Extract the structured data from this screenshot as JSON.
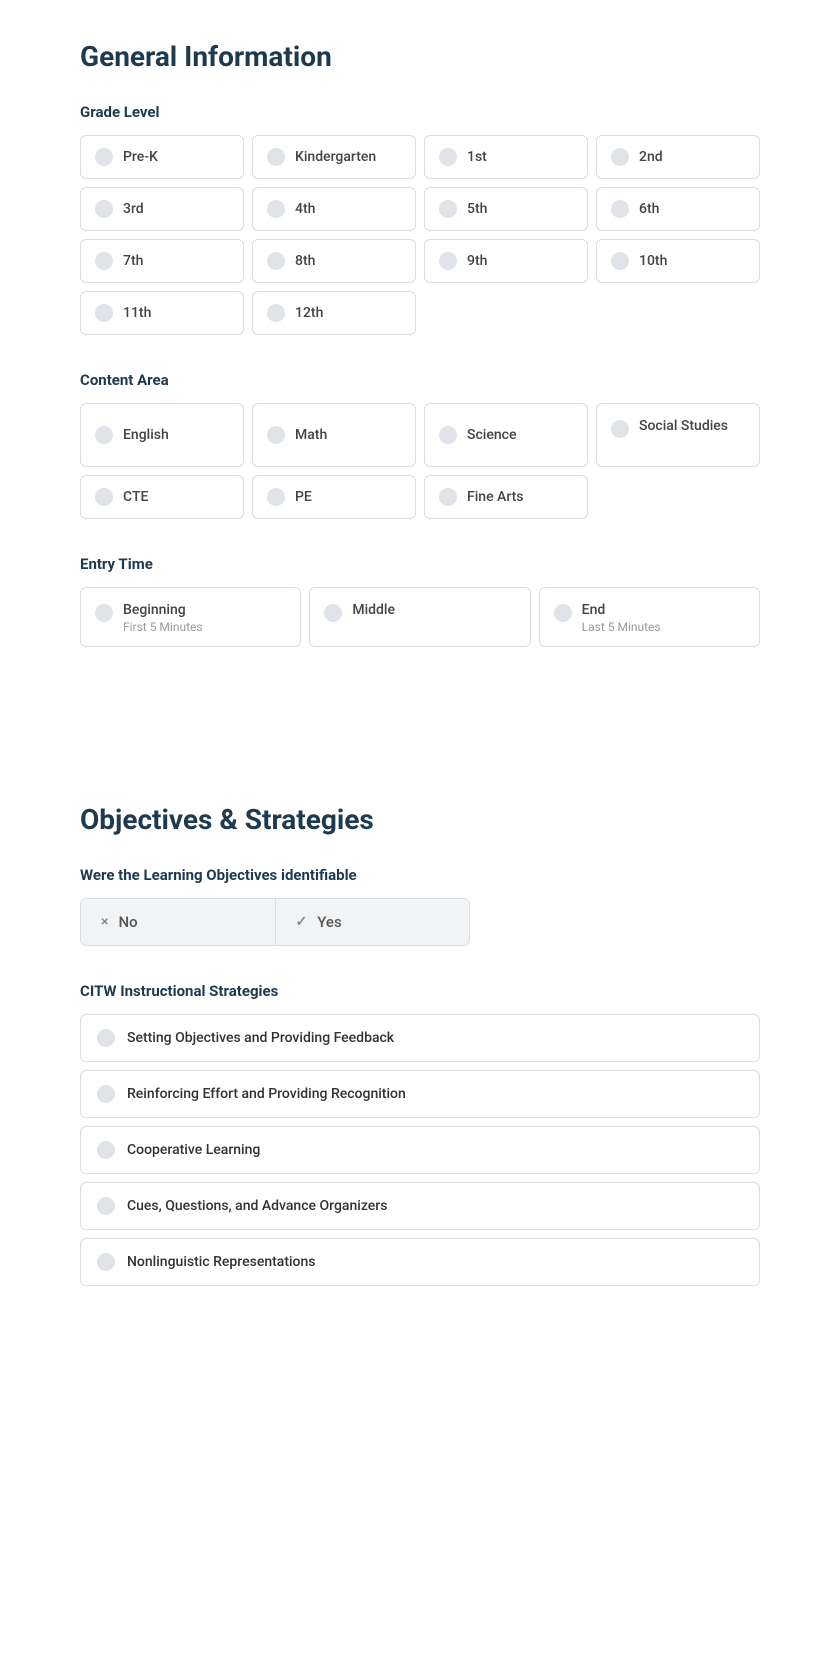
{
  "page": {
    "section1": {
      "title": "General Information",
      "grade_level": {
        "label": "Grade Level",
        "options": [
          {
            "id": "pre-k",
            "label": "Pre-K",
            "checked": false
          },
          {
            "id": "kindergarten",
            "label": "Kindergarten",
            "checked": false
          },
          {
            "id": "1st",
            "label": "1st",
            "checked": false
          },
          {
            "id": "2nd",
            "label": "2nd",
            "checked": false
          },
          {
            "id": "3rd",
            "label": "3rd",
            "checked": false
          },
          {
            "id": "4th",
            "label": "4th",
            "checked": false
          },
          {
            "id": "5th",
            "label": "5th",
            "checked": false
          },
          {
            "id": "6th",
            "label": "6th",
            "checked": false
          },
          {
            "id": "7th",
            "label": "7th",
            "checked": false
          },
          {
            "id": "8th",
            "label": "8th",
            "checked": false
          },
          {
            "id": "9th",
            "label": "9th",
            "checked": false
          },
          {
            "id": "10th",
            "label": "10th",
            "checked": false
          },
          {
            "id": "11th",
            "label": "11th",
            "checked": false
          },
          {
            "id": "12th",
            "label": "12th",
            "checked": false
          }
        ]
      },
      "content_area": {
        "label": "Content Area",
        "options": [
          {
            "id": "english",
            "label": "English",
            "checked": false
          },
          {
            "id": "math",
            "label": "Math",
            "checked": false
          },
          {
            "id": "science",
            "label": "Science",
            "checked": false
          },
          {
            "id": "social-studies",
            "label": "Social Studies",
            "checked": false
          },
          {
            "id": "cte",
            "label": "CTE",
            "checked": false
          },
          {
            "id": "pe",
            "label": "PE",
            "checked": false
          },
          {
            "id": "fine-arts",
            "label": "Fine Arts",
            "checked": false
          }
        ]
      },
      "entry_time": {
        "label": "Entry Time",
        "options": [
          {
            "id": "beginning",
            "label": "Beginning",
            "subtext": "First 5 Minutes",
            "checked": false
          },
          {
            "id": "middle",
            "label": "Middle",
            "subtext": "",
            "checked": false
          },
          {
            "id": "end",
            "label": "End",
            "subtext": "Last 5 Minutes",
            "checked": false
          }
        ]
      }
    },
    "section2": {
      "title": "Objectives & Strategies",
      "learning_objectives": {
        "label": "Were the Learning Objectives identifiable",
        "no_label": "No",
        "yes_label": "Yes",
        "no_icon": "×",
        "yes_icon": "✓"
      },
      "citw": {
        "label": "CITW Instructional Strategies",
        "strategies": [
          {
            "id": "setting-objectives",
            "label": "Setting Objectives and Providing Feedback"
          },
          {
            "id": "reinforcing-effort",
            "label": "Reinforcing Effort and Providing Recognition"
          },
          {
            "id": "cooperative-learning",
            "label": "Cooperative Learning"
          },
          {
            "id": "cues-questions",
            "label": "Cues, Questions, and Advance Organizers"
          },
          {
            "id": "nonlinguistic",
            "label": "Nonlinguistic Representations"
          }
        ]
      }
    }
  }
}
